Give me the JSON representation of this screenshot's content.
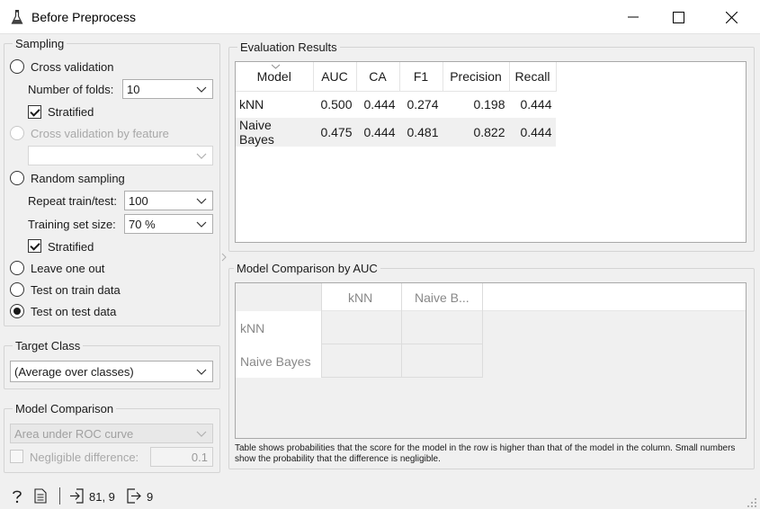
{
  "window": {
    "title": "Before Preprocess",
    "app_icon": "flask-icon"
  },
  "sampling": {
    "title": "Sampling",
    "cross_validation": {
      "label": "Cross validation",
      "checked": false
    },
    "number_of_folds": {
      "label": "Number of folds:",
      "value": "10"
    },
    "stratified_cv": {
      "label": "Stratified",
      "checked": true
    },
    "cv_by_feature": {
      "label": "Cross validation by feature",
      "enabled": false,
      "value": ""
    },
    "random_sampling": {
      "label": "Random sampling",
      "checked": false
    },
    "repeat_train_test": {
      "label": "Repeat train/test:",
      "value": "100"
    },
    "training_set_size": {
      "label": "Training set size:",
      "value": "70 %"
    },
    "stratified_rs": {
      "label": "Stratified",
      "checked": true
    },
    "leave_one_out": {
      "label": "Leave one out",
      "checked": false
    },
    "test_on_train": {
      "label": "Test on train data",
      "checked": false
    },
    "test_on_test": {
      "label": "Test on test data",
      "checked": true
    }
  },
  "target_class": {
    "title": "Target Class",
    "value": "(Average over classes)"
  },
  "model_comparison": {
    "title": "Model Comparison",
    "metric": "Area under ROC curve",
    "negligible_label": "Negligible difference:",
    "negligible_value": "0.1"
  },
  "evaluation": {
    "title": "Evaluation Results",
    "columns": [
      "Model",
      "AUC",
      "CA",
      "F1",
      "Precision",
      "Recall"
    ],
    "rows": [
      [
        "kNN",
        "0.500",
        "0.444",
        "0.274",
        "0.198",
        "0.444"
      ],
      [
        "Naive Bayes",
        "0.475",
        "0.444",
        "0.481",
        "0.822",
        "0.444"
      ]
    ]
  },
  "comparison": {
    "title": "Model Comparison by AUC",
    "col_headers": [
      "kNN",
      "Naive B..."
    ],
    "row_headers": [
      "kNN",
      "Naive Bayes"
    ],
    "note": "Table shows probabilities that the score for the model in the row is higher than that of the model in the column. Small numbers show the probability that the difference is negligible."
  },
  "status": {
    "input_summary": "81, 9",
    "output_summary": "9"
  }
}
